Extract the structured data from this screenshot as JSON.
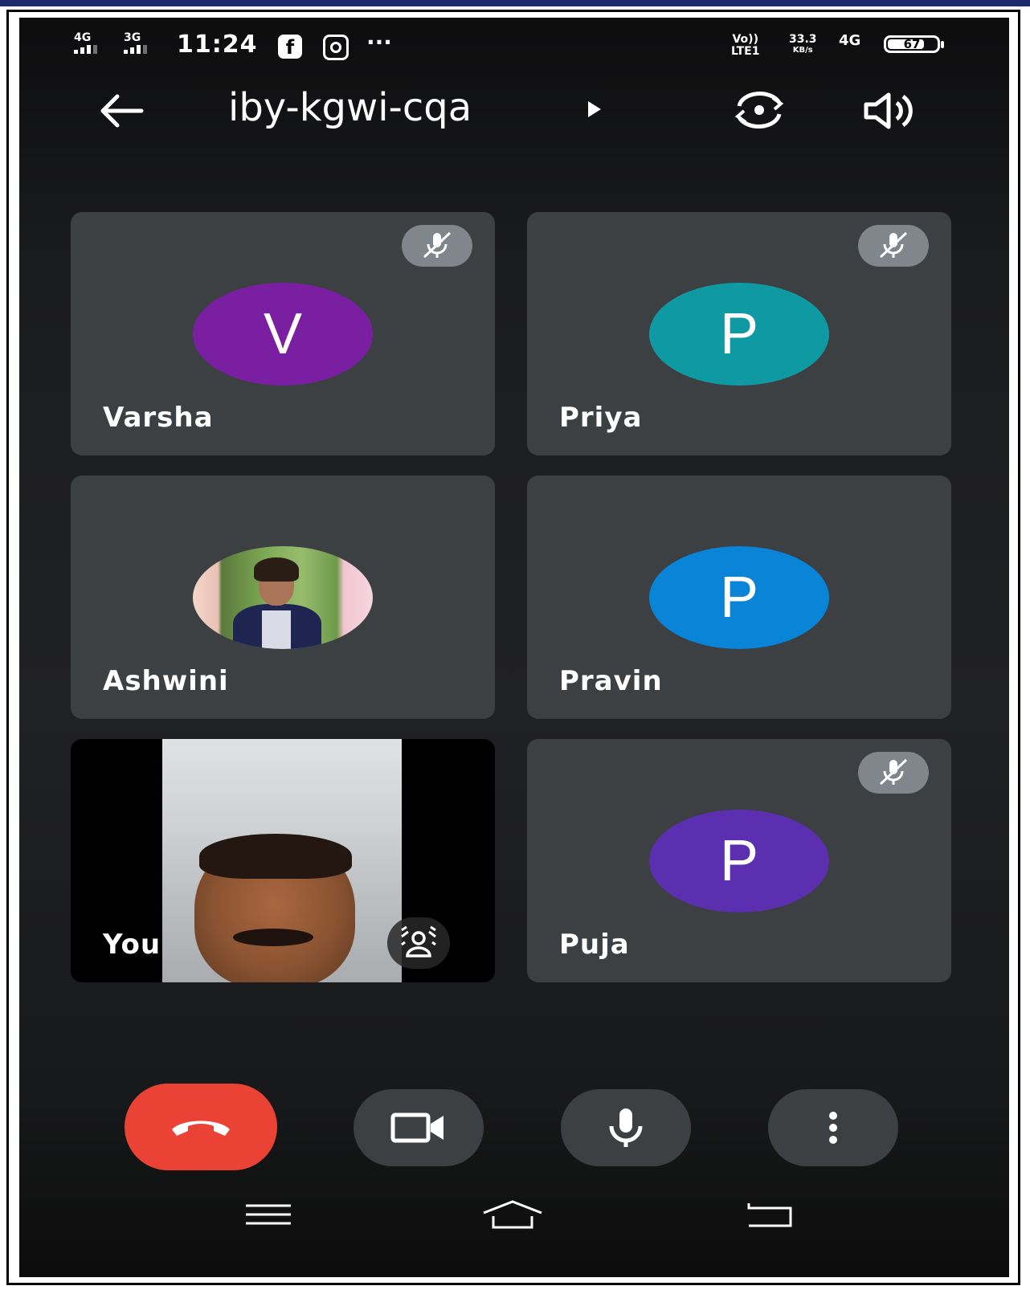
{
  "status_bar": {
    "network1": "4G",
    "network2": "3G",
    "time": "11:24",
    "volte_top": "Vo))",
    "volte_bottom": "LTE1",
    "speed_value": "33.3",
    "speed_unit": "KB/s",
    "network3": "4G",
    "battery": "67"
  },
  "header": {
    "meeting_code": "iby-kgwi-cqa"
  },
  "participants": [
    {
      "name": "Varsha",
      "initial": "V",
      "color": "#7b1fa2",
      "muted": true
    },
    {
      "name": "Priya",
      "initial": "P",
      "color": "#0f9aa3",
      "muted": true
    },
    {
      "name": "Ashwini",
      "initial": "",
      "color": "",
      "muted": false
    },
    {
      "name": "Pravin",
      "initial": "P",
      "color": "#0a84d6",
      "muted": false
    },
    {
      "name": "You",
      "initial": "",
      "color": "",
      "muted": false
    },
    {
      "name": "Puja",
      "initial": "P",
      "color": "#5b2fb0",
      "muted": true
    }
  ],
  "controls": {
    "end_call_color": "#ea4335",
    "button_color": "#3c4043"
  }
}
